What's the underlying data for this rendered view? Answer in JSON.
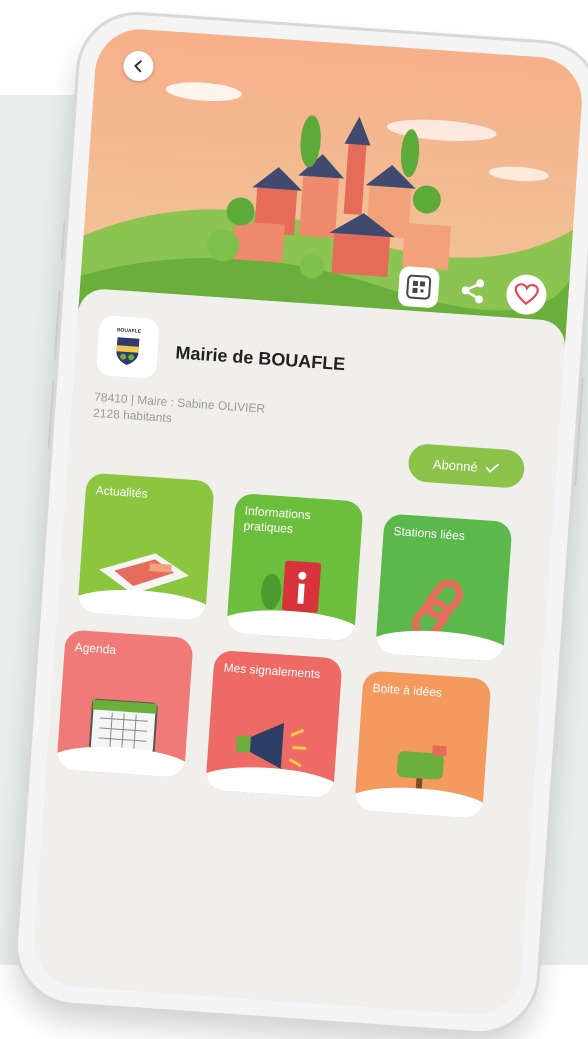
{
  "mairie": {
    "name": "Mairie de BOUAFLE",
    "logo_text": "BOUAFLE",
    "details_line1": "78410 | Maire : Sabine OLIVIER",
    "details_line2": "2128 habitants",
    "subscribe_label": "Abonné",
    "subscribe_icon": "check-icon"
  },
  "header": {
    "back_icon": "chevron-left-icon",
    "actions": [
      "qr-code-icon",
      "share-icon",
      "heart-icon"
    ]
  },
  "tiles": [
    {
      "label": "Actualités",
      "color": "#8cc63f",
      "icon": "newspaper-icon"
    },
    {
      "label": "Informations pratiques",
      "color": "#6cbf3c",
      "icon": "info-book-icon"
    },
    {
      "label": "Stations liées",
      "color": "#5cb84a",
      "icon": "chain-link-icon"
    },
    {
      "label": "Agenda",
      "color": "#ef7a78",
      "icon": "calendar-icon"
    },
    {
      "label": "Mes signalements",
      "color": "#ee6a64",
      "icon": "megaphone-icon"
    },
    {
      "label": "Boite à idées",
      "color": "#f49a5e",
      "icon": "mailbox-icon"
    }
  ],
  "colors": {
    "accent": "#8bc34a",
    "sky": "#f3a27e",
    "hills": "#6aae3c"
  }
}
